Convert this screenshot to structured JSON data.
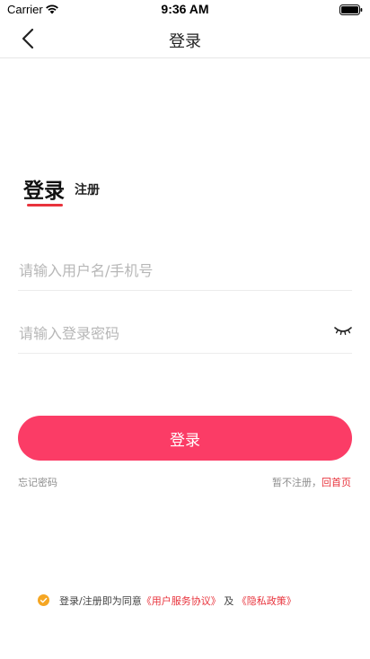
{
  "status_bar": {
    "carrier": "Carrier",
    "time": "9:36 AM"
  },
  "nav": {
    "title": "登录",
    "back_icon": "chevron-left-icon"
  },
  "tabs": {
    "login": "登录",
    "register": "注册",
    "active": "login"
  },
  "form": {
    "username_placeholder": "请输入用户名/手机号",
    "username_value": "",
    "password_placeholder": "请输入登录密码",
    "password_value": "",
    "password_toggle_icon": "eye-closed-icon"
  },
  "actions": {
    "login_label": "登录",
    "forgot_password": "忘记密码",
    "skip_text": "暂不注册，",
    "home_link": "回首页"
  },
  "agreement": {
    "prefix": "登录/注册即为同意",
    "user_agreement": "《用户服务协议》",
    "conjunction": "及",
    "privacy_policy": "《隐私政策》",
    "checked": true
  },
  "colors": {
    "primary": "#fb3c66",
    "accent_red": "#e8333c",
    "check_orange": "#f5a623",
    "muted_text": "#8d8d8d",
    "placeholder": "#b7b7b7"
  }
}
